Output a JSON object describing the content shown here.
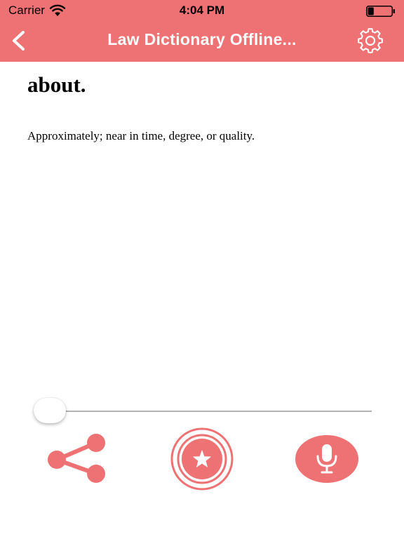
{
  "status_bar": {
    "carrier": "Carrier",
    "time": "4:04 PM",
    "battery_level": 0.25
  },
  "nav": {
    "title": "Law Dictionary Offline..."
  },
  "entry": {
    "word": "about.",
    "definition": "Approximately; near in time, degree, or quality."
  },
  "speech_slider": {
    "value": 0.0
  },
  "actions": {
    "share_icon": "share-icon",
    "favorite_icon": "star-icon",
    "mic_icon": "microphone-icon"
  },
  "colors": {
    "accent": "#ee7173",
    "text": "#000000",
    "background": "#ffffff"
  }
}
